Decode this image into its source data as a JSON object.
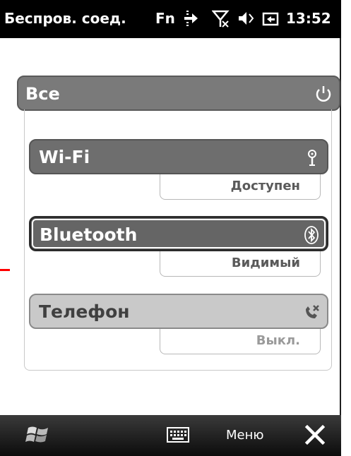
{
  "status_bar": {
    "title": "Беспров. соед.",
    "fn": "Fn",
    "time": "13:52",
    "icons": [
      "data-transfer-icon",
      "no-signal-icon",
      "speaker-muted-icon",
      "battery-charging-icon"
    ]
  },
  "all": {
    "label": "Все",
    "icon": "power-icon"
  },
  "items": [
    {
      "label": "Wi-Fi",
      "status": "Доступен",
      "icon": "wifi-antenna-icon"
    },
    {
      "label": "Bluetooth",
      "status": "Видимый",
      "icon": "bluetooth-icon"
    },
    {
      "label": "Телефон",
      "status": "Выкл.",
      "icon": "phone-off-icon"
    }
  ],
  "bottom_bar": {
    "menu_label": "Меню",
    "start_icon": "windows-start-icon",
    "keyboard_icon": "keyboard-icon",
    "close_icon": "close-icon"
  },
  "colors": {
    "status_bar_bg": "#000000",
    "bar_gray": "#6e6e6e",
    "bar_light": "#c9c9c9",
    "marker": "#ff0000"
  }
}
